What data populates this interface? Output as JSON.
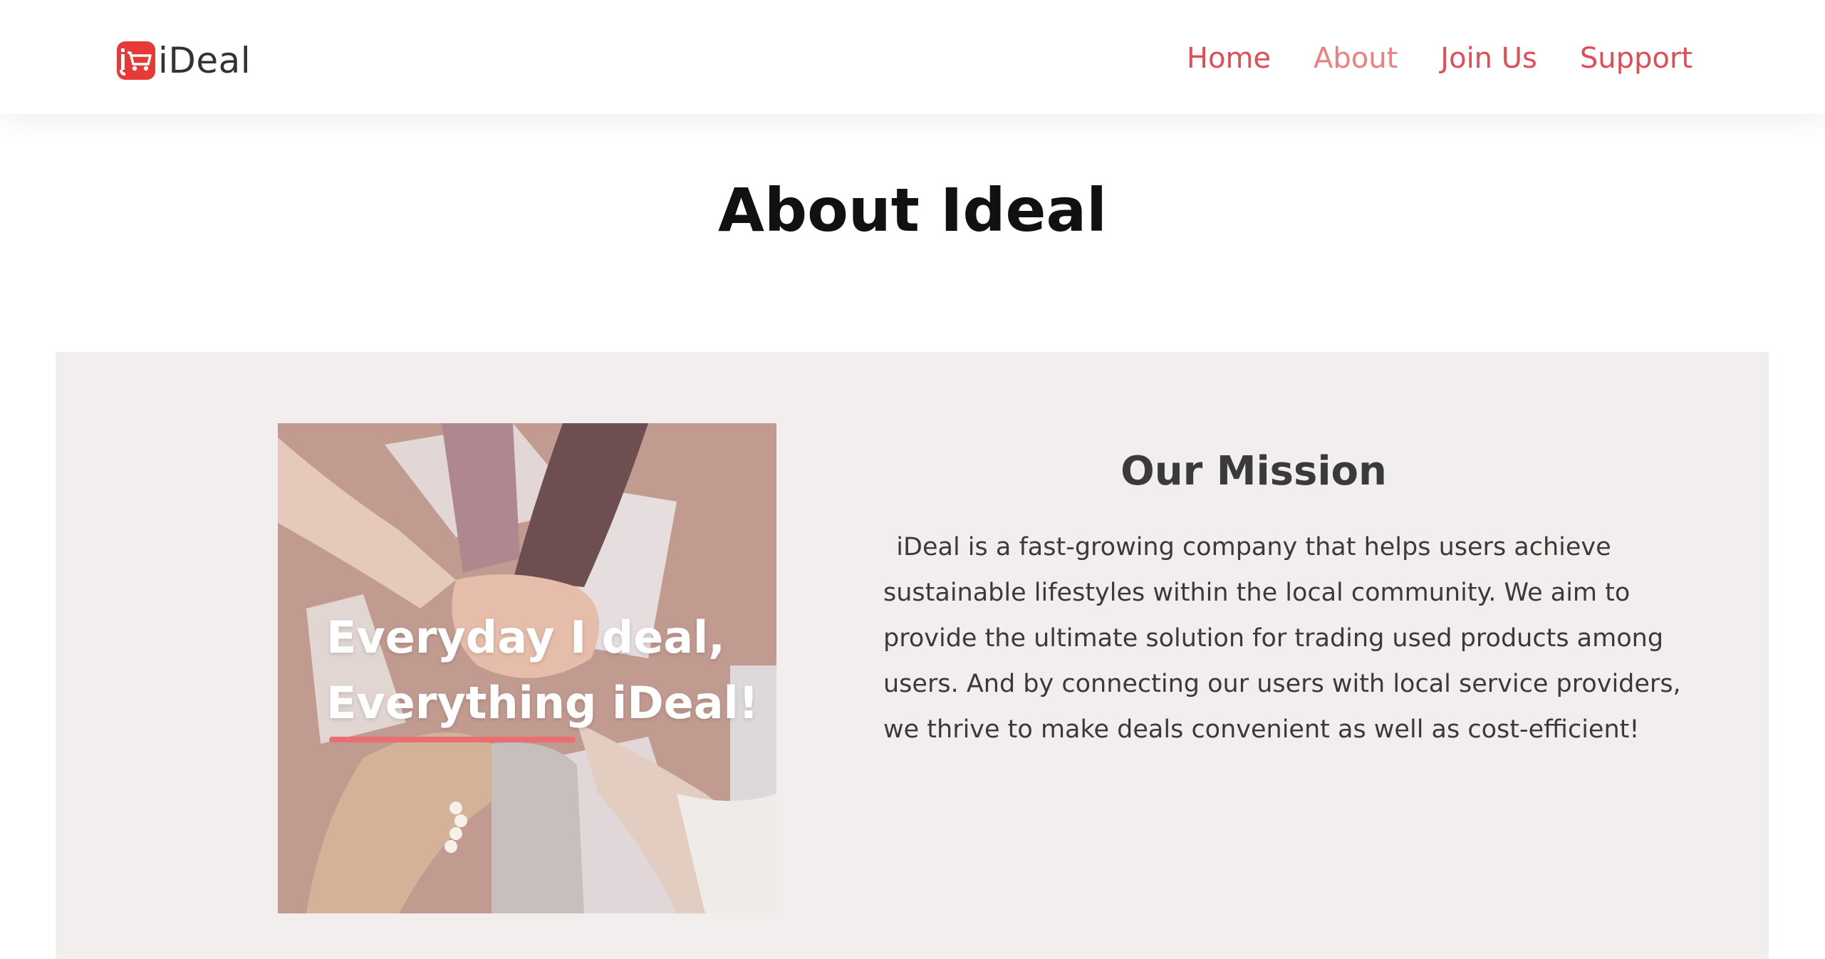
{
  "brand": {
    "name": "iDeal",
    "logo_icon": "shopping-cart-icon",
    "logo_color": "#e53a36"
  },
  "nav": {
    "items": [
      {
        "label": "Home",
        "active": false
      },
      {
        "label": "About",
        "active": true
      },
      {
        "label": "Join Us",
        "active": false
      },
      {
        "label": "Support",
        "active": false
      }
    ],
    "color": "#e24c55",
    "active_color": "#ef7f7f"
  },
  "page": {
    "title": "About Ideal"
  },
  "mission": {
    "image_caption_lines": [
      "Everyday I deal,",
      "Everything iDeal!"
    ],
    "title": "Our Mission",
    "text_lines": [
      "iDeal is a fast-growing company that helps users achieve",
      "sustainable lifestyles within the local community. We aim to",
      "provide the ultimate solution for trading used products among",
      "users. And by connecting our users with local service providers,",
      "we thrive to make deals convenient as well as cost-efficient!"
    ],
    "panel_color": "#f2eeed"
  }
}
